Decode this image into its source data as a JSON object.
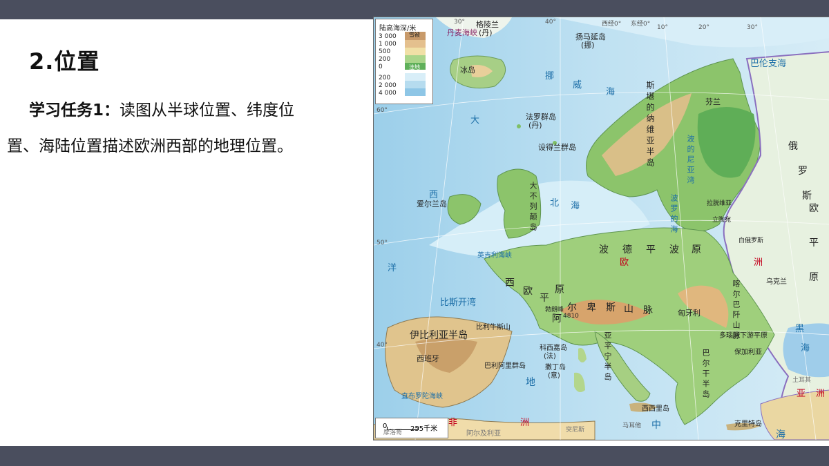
{
  "slide": {
    "title": "2.位置",
    "task_label": "学习任务1：",
    "task_text_line1": "读图从半球位置、纬度位",
    "task_text_line2": "置、海陆位置描述欧洲西部的地理位置。"
  },
  "map": {
    "legend": {
      "title": "陆高海深/米",
      "rows": [
        {
          "label": "3 000",
          "color": "#c89a6a"
        },
        {
          "label": "1 000",
          "color": "#e4c08e"
        },
        {
          "label": "500",
          "color": "#f0e0a6"
        },
        {
          "label": "200",
          "color": "#a9d58a"
        },
        {
          "label": "0",
          "color": "#5fb05a"
        },
        {
          "label": "200",
          "color": "#d8eef8"
        },
        {
          "label": "2 000",
          "color": "#b6dcef"
        },
        {
          "label": "4 000",
          "color": "#8ec6e6"
        }
      ],
      "snow_label": "雪被",
      "land_label": "洼地"
    },
    "scale": {
      "zero": "0",
      "distance": "255千米"
    },
    "labels": [
      {
        "text": "格陵兰",
        "cls": ""
      },
      {
        "text": "(丹)",
        "cls": ""
      },
      {
        "text": "丹麦海峡",
        "cls": ""
      },
      {
        "text": "扬马延岛",
        "cls": ""
      },
      {
        "text": "(挪)",
        "cls": ""
      },
      {
        "text": "巴伦支海",
        "cls": "sea"
      },
      {
        "text": "冰岛",
        "cls": ""
      },
      {
        "text": "挪",
        "cls": "sea"
      },
      {
        "text": "威",
        "cls": "sea"
      },
      {
        "text": "海",
        "cls": "sea"
      },
      {
        "text": "大",
        "cls": "sea"
      },
      {
        "text": "法罗群岛",
        "cls": ""
      },
      {
        "text": "(丹)",
        "cls": ""
      },
      {
        "text": "设得兰群岛",
        "cls": ""
      },
      {
        "text": "斯堪的纳维亚半岛",
        "cls": ""
      },
      {
        "text": "芬兰",
        "cls": ""
      },
      {
        "text": "俄",
        "cls": ""
      },
      {
        "text": "罗",
        "cls": ""
      },
      {
        "text": "斯",
        "cls": ""
      },
      {
        "text": "欧",
        "cls": "big"
      },
      {
        "text": "平",
        "cls": "big"
      },
      {
        "text": "原",
        "cls": "big"
      },
      {
        "text": "西",
        "cls": "sea"
      },
      {
        "text": "洋",
        "cls": "sea"
      },
      {
        "text": "爱尔兰岛",
        "cls": ""
      },
      {
        "text": "大不列颠岛",
        "cls": ""
      },
      {
        "text": "北",
        "cls": "sea"
      },
      {
        "text": "海",
        "cls": "sea"
      },
      {
        "text": "波的尼亚湾",
        "cls": "sea"
      },
      {
        "text": "波罗的海",
        "cls": "sea"
      },
      {
        "text": "拉脱维亚",
        "cls": ""
      },
      {
        "text": "立陶宛",
        "cls": ""
      },
      {
        "text": "白俄罗斯",
        "cls": ""
      },
      {
        "text": "乌克兰",
        "cls": ""
      },
      {
        "text": "英吉利海峡",
        "cls": "sea"
      },
      {
        "text": "波",
        "cls": "big"
      },
      {
        "text": "德",
        "cls": "big"
      },
      {
        "text": "平",
        "cls": "big"
      },
      {
        "text": "波",
        "cls": "big"
      },
      {
        "text": "原",
        "cls": "big"
      },
      {
        "text": "欧",
        "cls": "red"
      },
      {
        "text": "洲",
        "cls": "red"
      },
      {
        "text": "西",
        "cls": "big"
      },
      {
        "text": "欧",
        "cls": "big"
      },
      {
        "text": "平",
        "cls": "big"
      },
      {
        "text": "原",
        "cls": "big"
      },
      {
        "text": "比斯开湾",
        "cls": "sea"
      },
      {
        "text": "阿",
        "cls": "big"
      },
      {
        "text": "尔",
        "cls": "big"
      },
      {
        "text": "卑",
        "cls": "big"
      },
      {
        "text": "斯",
        "cls": "big"
      },
      {
        "text": "山",
        "cls": "big"
      },
      {
        "text": "脉",
        "cls": "big"
      },
      {
        "text": "勃朗峰",
        "cls": ""
      },
      {
        "text": "4810",
        "cls": ""
      },
      {
        "text": "喀尔巴阡山脉",
        "cls": ""
      },
      {
        "text": "匈牙利",
        "cls": ""
      },
      {
        "text": "多瑙河下游平原",
        "cls": ""
      },
      {
        "text": "黑",
        "cls": "sea"
      },
      {
        "text": "海",
        "cls": "sea"
      },
      {
        "text": "伊比利亚半岛",
        "cls": "big"
      },
      {
        "text": "比利牛斯山",
        "cls": ""
      },
      {
        "text": "西班牙",
        "cls": ""
      },
      {
        "text": "科西嘉岛",
        "cls": ""
      },
      {
        "text": "(法)",
        "cls": ""
      },
      {
        "text": "撒丁岛",
        "cls": ""
      },
      {
        "text": "(意)",
        "cls": ""
      },
      {
        "text": "巴利阿里群岛",
        "cls": ""
      },
      {
        "text": "亚平宁半岛",
        "cls": ""
      },
      {
        "text": "巴尔干半岛",
        "cls": ""
      },
      {
        "text": "保加利亚",
        "cls": ""
      },
      {
        "text": "直布罗陀海峡",
        "cls": "sea"
      },
      {
        "text": "地",
        "cls": "sea"
      },
      {
        "text": "中",
        "cls": "sea"
      },
      {
        "text": "海",
        "cls": "sea"
      },
      {
        "text": "西西里岛",
        "cls": ""
      },
      {
        "text": "克里特岛",
        "cls": ""
      },
      {
        "text": "摩洛哥",
        "cls": ""
      },
      {
        "text": "阿尔及利亚",
        "cls": ""
      },
      {
        "text": "突尼斯",
        "cls": ""
      },
      {
        "text": "马耳他",
        "cls": ""
      },
      {
        "text": "非",
        "cls": "red"
      },
      {
        "text": "洲",
        "cls": "red"
      },
      {
        "text": "亚",
        "cls": "red"
      },
      {
        "text": "洲",
        "cls": "red"
      },
      {
        "text": "土耳其",
        "cls": ""
      }
    ],
    "graticule": [
      "30°",
      "40°",
      "西经0°",
      "东经0°",
      "10°",
      "20°",
      "30°",
      "60°",
      "50°",
      "40°"
    ]
  }
}
